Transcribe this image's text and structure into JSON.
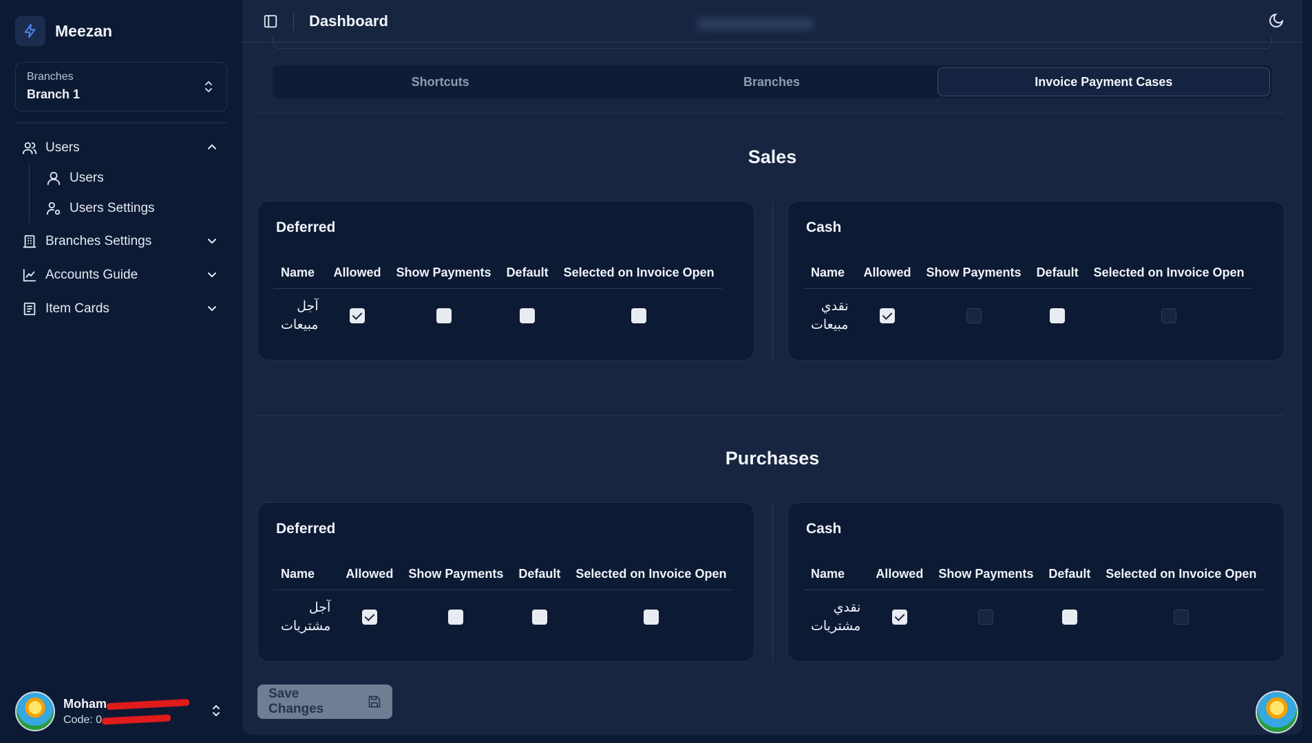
{
  "app": {
    "name": "Meezan"
  },
  "branch_select": {
    "label": "Branches",
    "value": "Branch 1"
  },
  "nav": {
    "users": "Users",
    "users_sub": [
      "Users",
      "Users Settings"
    ],
    "branches_settings": "Branches Settings",
    "accounts_guide": "Accounts Guide",
    "item_cards": "Item Cards"
  },
  "user": {
    "name": "Moham",
    "code": "Code: 0"
  },
  "header": {
    "title": "Dashboard"
  },
  "tabs": [
    "Shortcuts",
    "Branches",
    "Invoice Payment Cases"
  ],
  "active_tab": "Invoice Payment Cases",
  "columns": [
    "Name",
    "Allowed",
    "Show Payments",
    "Default",
    "Selected on Invoice Open"
  ],
  "sections": [
    {
      "title": "Sales",
      "cards": [
        {
          "title": "Deferred",
          "name_line1": "آجل",
          "name_line2": "مبيعات",
          "allowed": true,
          "show_payments": false,
          "default": false,
          "selected": false,
          "show_payments_enabled": true,
          "selected_enabled": true
        },
        {
          "title": "Cash",
          "name_line1": "نقدي",
          "name_line2": "مبيعات",
          "allowed": true,
          "show_payments": false,
          "default": false,
          "selected": false,
          "show_payments_enabled": false,
          "selected_enabled": false
        }
      ]
    },
    {
      "title": "Purchases",
      "cards": [
        {
          "title": "Deferred",
          "name_line1": "آجل",
          "name_line2": "مشتريات",
          "allowed": true,
          "show_payments": false,
          "default": false,
          "selected": false,
          "show_payments_enabled": true,
          "selected_enabled": true
        },
        {
          "title": "Cash",
          "name_line1": "نقدي",
          "name_line2": "مشتريات",
          "allowed": true,
          "show_payments": false,
          "default": false,
          "selected": false,
          "show_payments_enabled": false,
          "selected_enabled": false
        }
      ]
    }
  ],
  "save_button": {
    "label": "Save Changes"
  },
  "icons": {
    "brand": "bolt-icon",
    "sidebar_toggle": "sidebar-toggle-icon",
    "theme": "moon-icon",
    "save": "save-icon",
    "users": "users-icon",
    "user": "user-icon",
    "user_settings": "user-cog-icon",
    "building": "building-icon",
    "chart": "chart-icon",
    "cards": "item-cards-icon"
  }
}
